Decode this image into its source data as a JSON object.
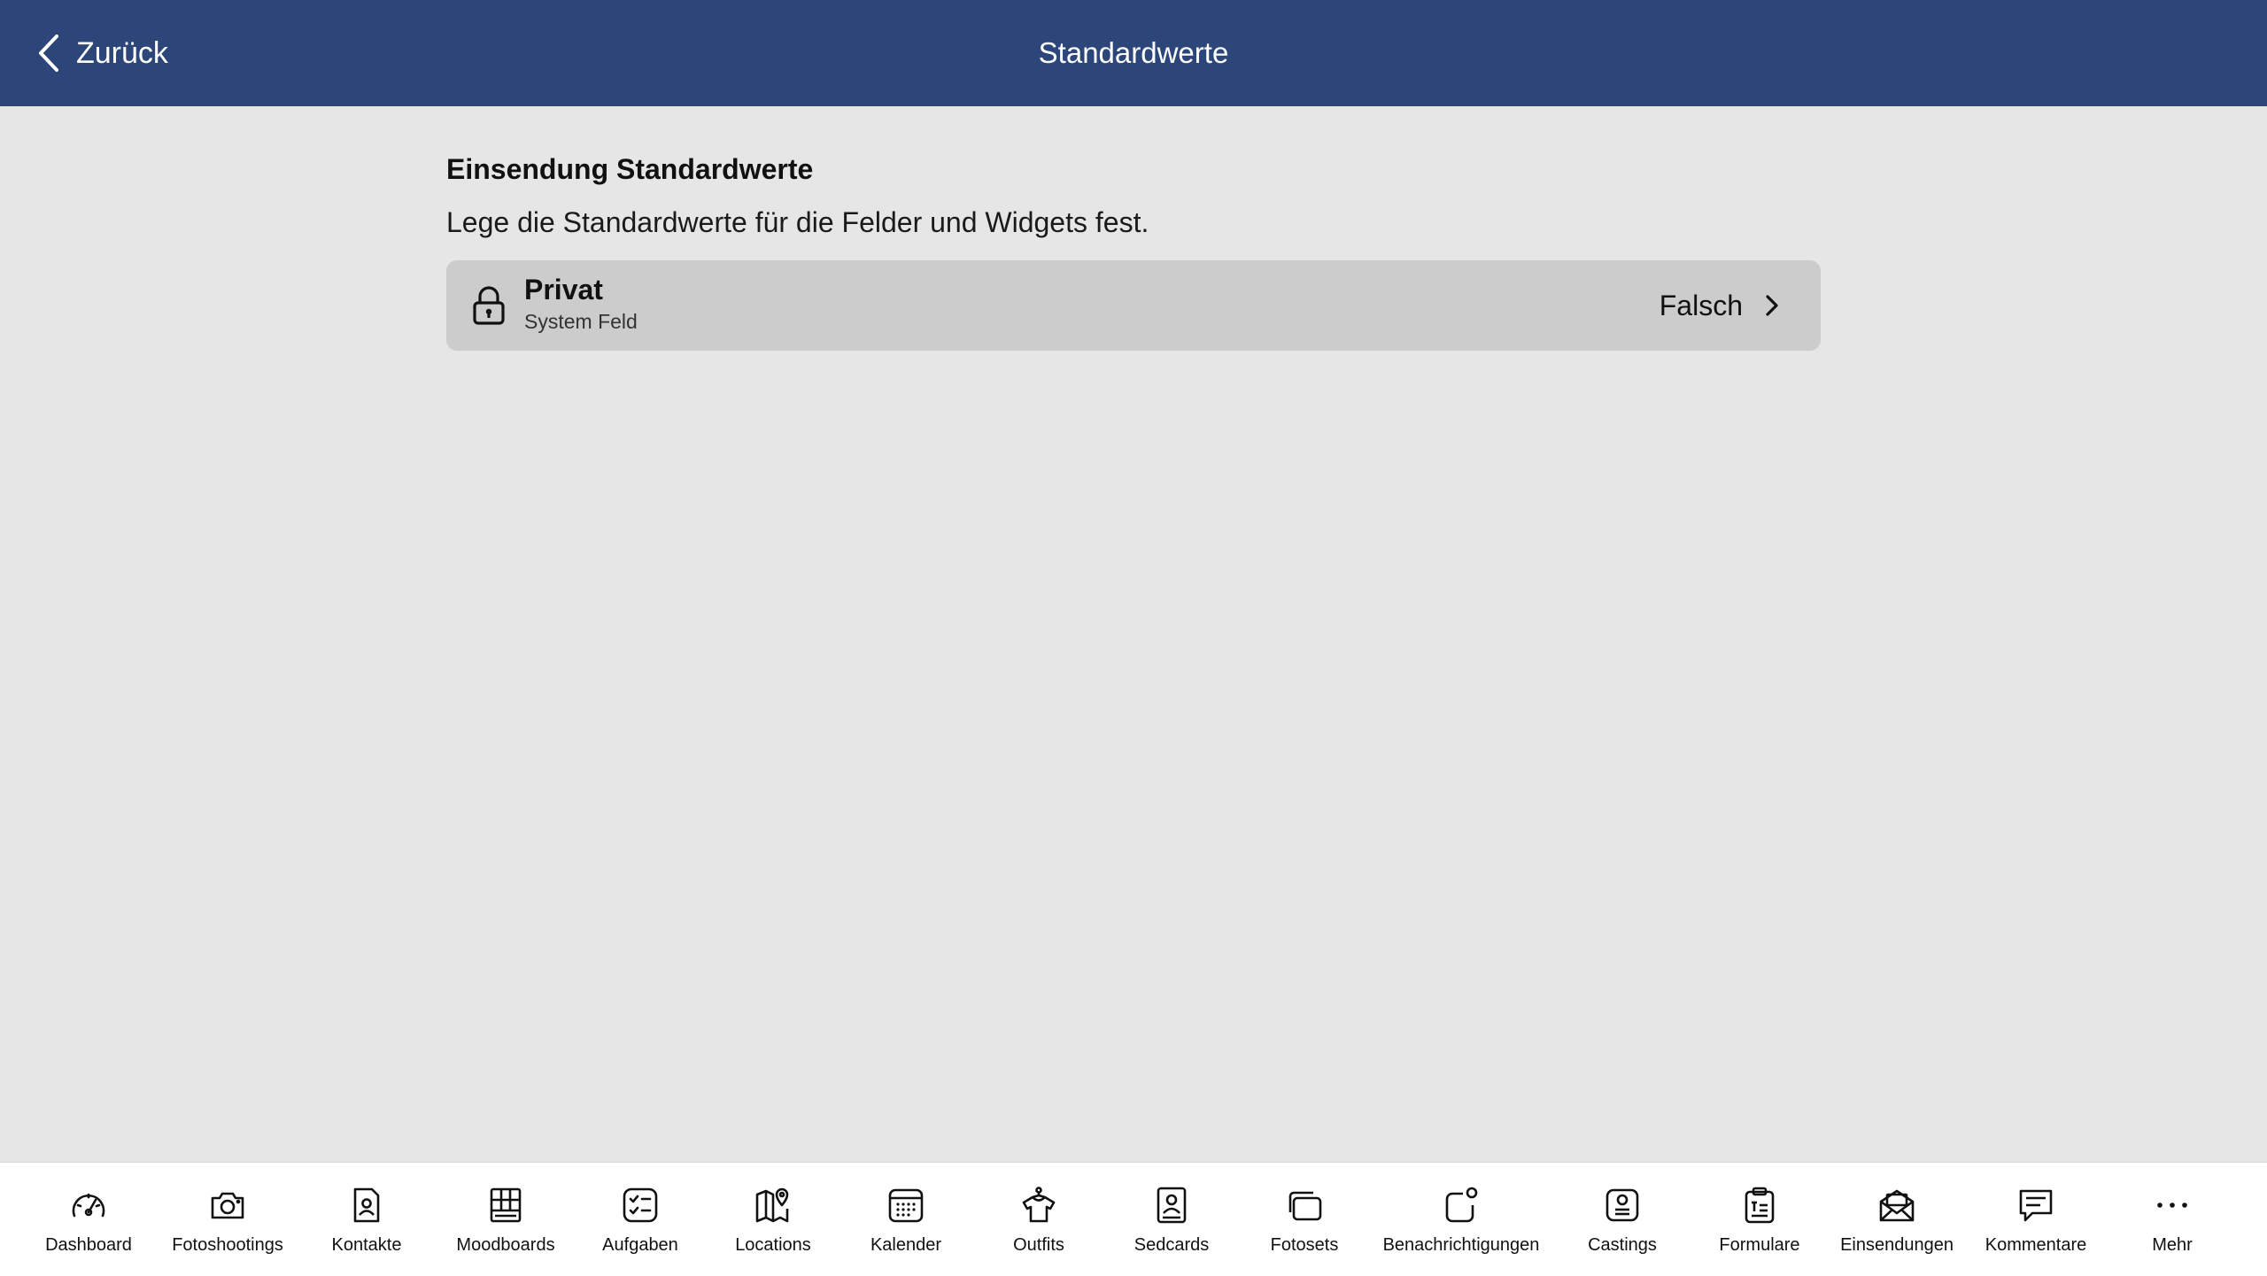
{
  "header": {
    "back_label": "Zurück",
    "title": "Standardwerte",
    "background": "#2c4679"
  },
  "main": {
    "section_title": "Einsendung Standardwerte",
    "section_description": "Lege die Standardwerte für die Felder und Widgets fest.",
    "field": {
      "icon": "lock-icon",
      "name": "Privat",
      "subtitle": "System Feld",
      "value": "Falsch"
    }
  },
  "tabbar": {
    "items": [
      {
        "label": "Dashboard",
        "icon": "gauge-icon"
      },
      {
        "label": "Fotoshootings",
        "icon": "camera-icon"
      },
      {
        "label": "Kontakte",
        "icon": "contact-card-icon"
      },
      {
        "label": "Moodboards",
        "icon": "moodboard-grid-icon"
      },
      {
        "label": "Aufgaben",
        "icon": "checklist-icon"
      },
      {
        "label": "Locations",
        "icon": "map-pin-icon"
      },
      {
        "label": "Kalender",
        "icon": "calendar-icon"
      },
      {
        "label": "Outfits",
        "icon": "shirt-hanger-icon"
      },
      {
        "label": "Sedcards",
        "icon": "portrait-card-icon"
      },
      {
        "label": "Fotosets",
        "icon": "photo-stack-icon"
      },
      {
        "label": "Benachrichtigungen",
        "icon": "notification-icon"
      },
      {
        "label": "Castings",
        "icon": "casting-icon"
      },
      {
        "label": "Formulare",
        "icon": "clipboard-form-icon"
      },
      {
        "label": "Einsendungen",
        "icon": "envelope-icon"
      },
      {
        "label": "Kommentare",
        "icon": "comment-icon"
      },
      {
        "label": "Mehr",
        "icon": "more-dots-icon"
      }
    ]
  }
}
